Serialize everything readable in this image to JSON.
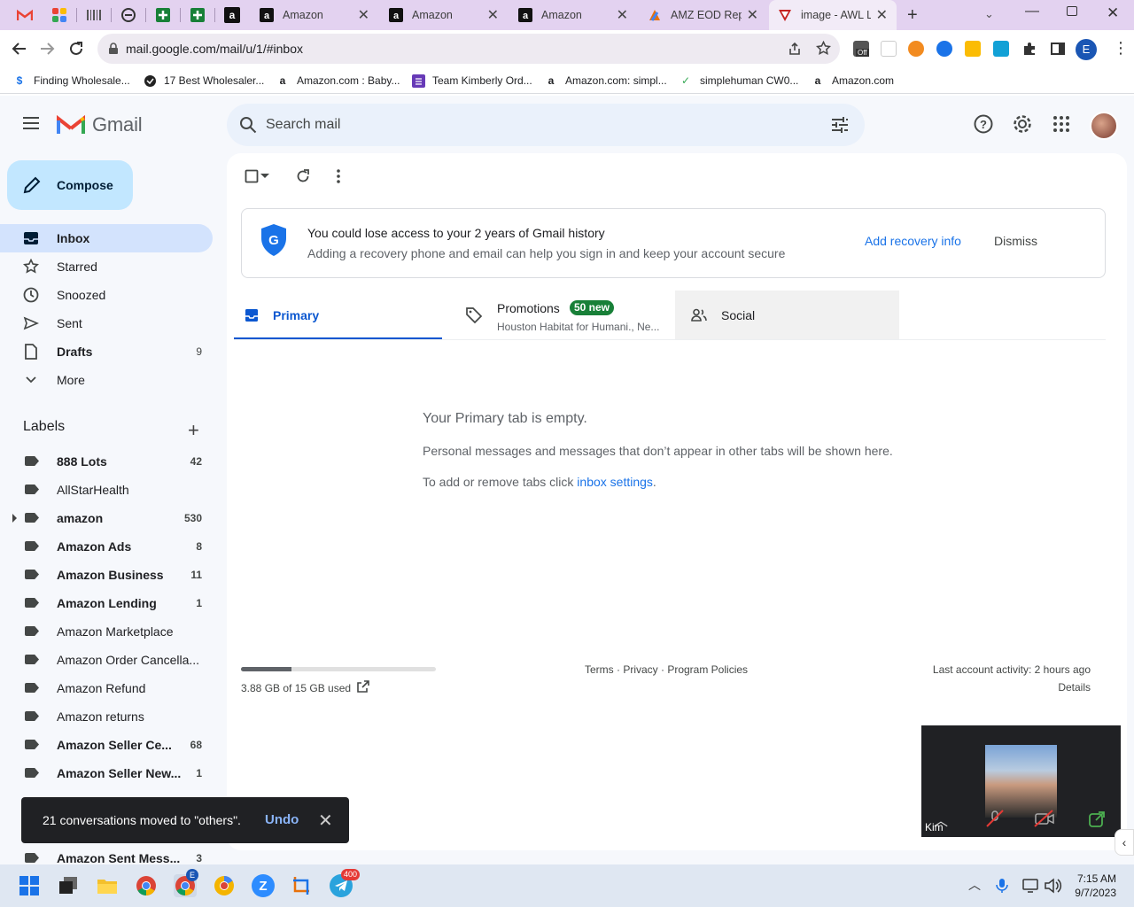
{
  "browser": {
    "tabs": [
      {
        "title": "Amazon"
      },
      {
        "title": "Amazon"
      },
      {
        "title": "Amazon"
      },
      {
        "title": "AMZ EOD Repo"
      },
      {
        "title": "image - AWL La"
      }
    ],
    "url": "mail.google.com/mail/u/1/#inbox",
    "profile_initial": "E",
    "extension_badge": "Off"
  },
  "bookmarks": [
    {
      "label": "Finding Wholesale..."
    },
    {
      "label": "17 Best Wholesaler..."
    },
    {
      "label": "Amazon.com : Baby..."
    },
    {
      "label": "Team Kimberly Ord..."
    },
    {
      "label": "Amazon.com: simpl..."
    },
    {
      "label": "simplehuman CW0..."
    },
    {
      "label": "Amazon.com"
    }
  ],
  "gmail": {
    "brand": "Gmail",
    "search_placeholder": "Search mail",
    "compose_label": "Compose",
    "nav": [
      {
        "label": "Inbox",
        "count": ""
      },
      {
        "label": "Starred",
        "count": ""
      },
      {
        "label": "Snoozed",
        "count": ""
      },
      {
        "label": "Sent",
        "count": ""
      },
      {
        "label": "Drafts",
        "count": "9"
      },
      {
        "label": "More",
        "count": ""
      }
    ],
    "labels_heading": "Labels",
    "labels": [
      {
        "label": "888 Lots",
        "count": "42"
      },
      {
        "label": "AllStarHealth",
        "count": ""
      },
      {
        "label": "amazon",
        "count": "530"
      },
      {
        "label": "Amazon Ads",
        "count": "8"
      },
      {
        "label": "Amazon Business",
        "count": "11"
      },
      {
        "label": "Amazon Lending",
        "count": "1"
      },
      {
        "label": "Amazon Marketplace",
        "count": ""
      },
      {
        "label": "Amazon Order Cancella...",
        "count": ""
      },
      {
        "label": "Amazon Refund",
        "count": ""
      },
      {
        "label": "Amazon returns",
        "count": ""
      },
      {
        "label": "Amazon Seller Ce...",
        "count": "68"
      },
      {
        "label": "Amazon Seller New...",
        "count": "1"
      },
      {
        "label": "Amazon Sent Mess...",
        "count": "3"
      }
    ],
    "banner": {
      "title": "You could lose access to your 2 years of Gmail history",
      "subtitle": "Adding a recovery phone and email can help you sign in and keep your account secure",
      "action": "Add recovery info",
      "dismiss": "Dismiss"
    },
    "tabs": {
      "primary": "Primary",
      "promotions": "Promotions",
      "promotions_badge": "50 new",
      "promotions_sub": "Houston Habitat for Humani., Ne...",
      "social": "Social"
    },
    "empty": {
      "title": "Your Primary tab is empty.",
      "desc": "Personal messages and messages that don’t appear in other tabs will be shown here.",
      "hint_prefix": "To add or remove tabs click ",
      "hint_link": "inbox settings",
      "hint_suffix": "."
    },
    "footer": {
      "storage": "3.88 GB of 15 GB used",
      "storage_fraction": 0.26,
      "links": "Terms · Privacy · Program Policies",
      "last_activity": "Last account activity: 2 hours ago",
      "details": "Details"
    },
    "snackbar": {
      "message": "21 conversations moved to \"others\".",
      "undo": "Undo"
    }
  },
  "video": {
    "name": "Kim"
  },
  "taskbar": {
    "time": "7:15 AM",
    "date": "9/7/2023",
    "chrome_badge": "E",
    "telegram_badge": "400"
  }
}
